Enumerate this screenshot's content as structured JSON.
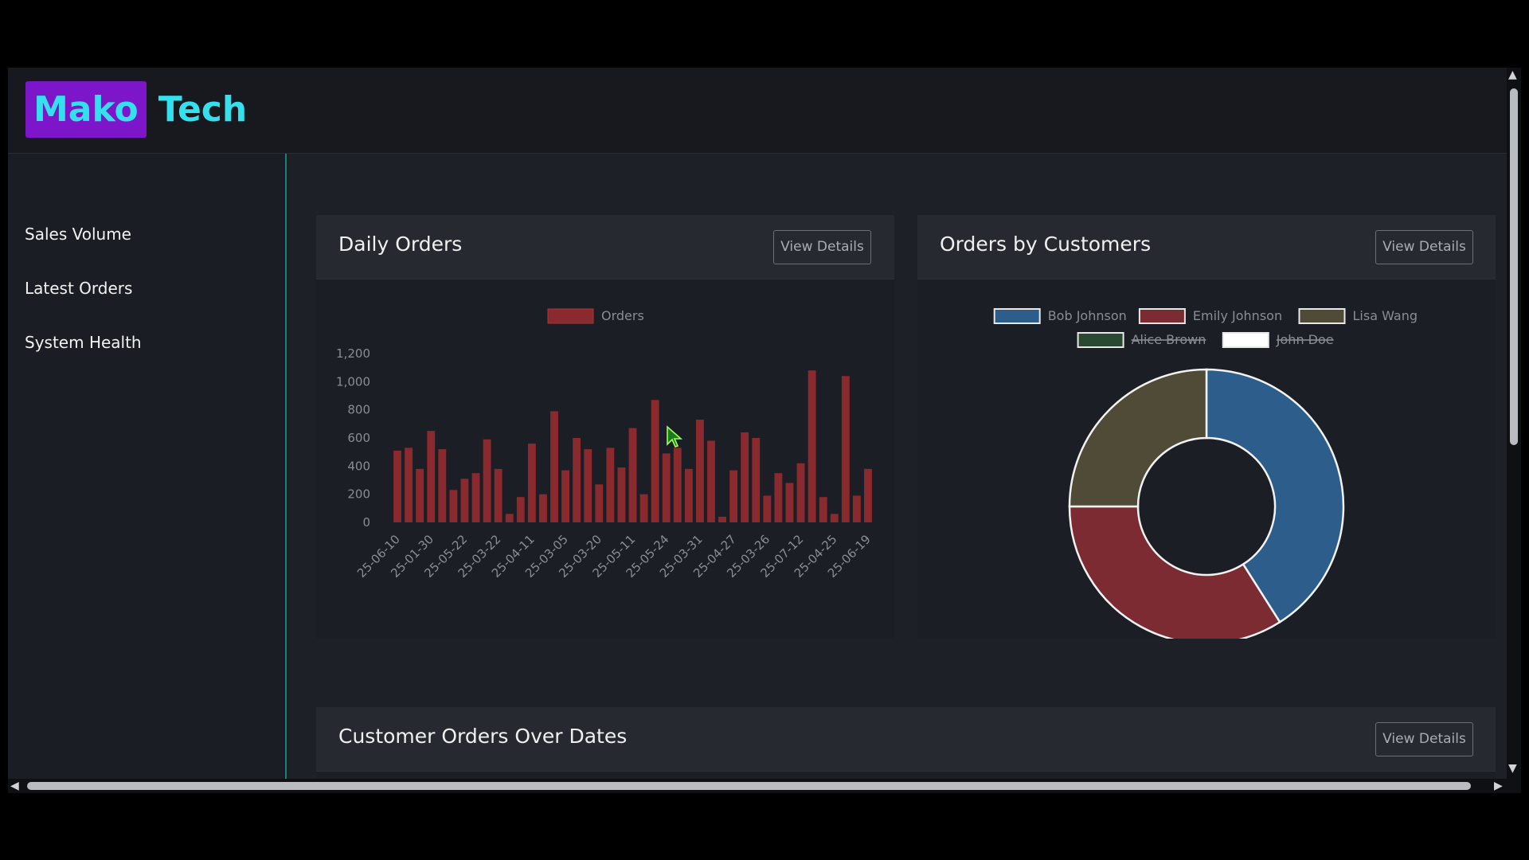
{
  "header": {
    "logo_part1": "Mako",
    "logo_part2": "Tech"
  },
  "sidebar": {
    "items": [
      {
        "label": "Sales Volume"
      },
      {
        "label": "Latest Orders"
      },
      {
        "label": "System Health"
      }
    ]
  },
  "cards": {
    "daily_orders": {
      "title": "Daily Orders",
      "button": "View Details"
    },
    "orders_by_customers": {
      "title": "Orders by Customers",
      "button": "View Details"
    },
    "customer_orders_over_dates": {
      "title": "Customer Orders Over Dates",
      "button": "View Details"
    }
  },
  "colors": {
    "accent": "#35e0ee",
    "logo_bg": "#7d16c8",
    "bar": "#8b2a2e",
    "divider": "#1e7f80"
  },
  "chart_data": [
    {
      "type": "bar",
      "title": "",
      "series": [
        {
          "name": "Orders",
          "values": [
            510,
            530,
            380,
            650,
            520,
            230,
            310,
            350,
            590,
            380,
            60,
            180,
            560,
            200,
            790,
            370,
            600,
            520,
            270,
            530,
            390,
            670,
            200,
            870,
            490,
            530,
            380,
            730,
            580,
            40,
            370,
            640,
            600,
            190,
            350,
            280,
            420,
            1080,
            180,
            60,
            1040,
            190,
            380
          ]
        }
      ],
      "x_tick_labels": [
        "25-06-10",
        "25-01-30",
        "25-05-22",
        "25-03-22",
        "25-04-11",
        "25-03-05",
        "25-03-20",
        "25-05-11",
        "25-05-24",
        "25-03-31",
        "25-04-27",
        "25-03-26",
        "25-07-12",
        "25-04-25",
        "25-06-19"
      ],
      "y_ticks": [
        0,
        200,
        400,
        600,
        800,
        1000,
        1200
      ],
      "y_tick_labels": [
        "0",
        "200",
        "400",
        "600",
        "800",
        "1,000",
        "1,200"
      ],
      "ylim": [
        0,
        1200
      ],
      "legend": "top-center",
      "grid": false,
      "color": "#8b2a2e"
    },
    {
      "type": "pie",
      "variant": "doughnut",
      "categories": [
        "Bob Johnson",
        "Emily Johnson",
        "Lisa Wang",
        "Alice Brown",
        "John Doe"
      ],
      "hidden": [
        "Alice Brown",
        "John Doe"
      ],
      "values": [
        41,
        34,
        25,
        0,
        0
      ],
      "colors": [
        "#2d5d8a",
        "#7c2b33",
        "#4f4b37",
        "#294a30",
        "#ffffff"
      ],
      "legend": "top-center"
    }
  ]
}
